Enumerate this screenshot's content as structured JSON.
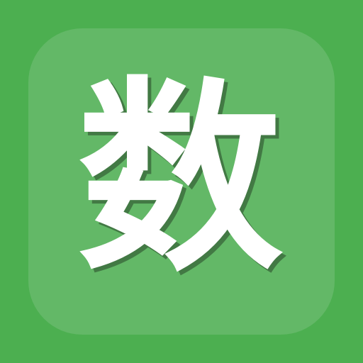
{
  "icon": {
    "glyph": "数",
    "background_color": "#4caf50",
    "tile_color": "#63b867",
    "glyph_color": "#ffffff"
  }
}
